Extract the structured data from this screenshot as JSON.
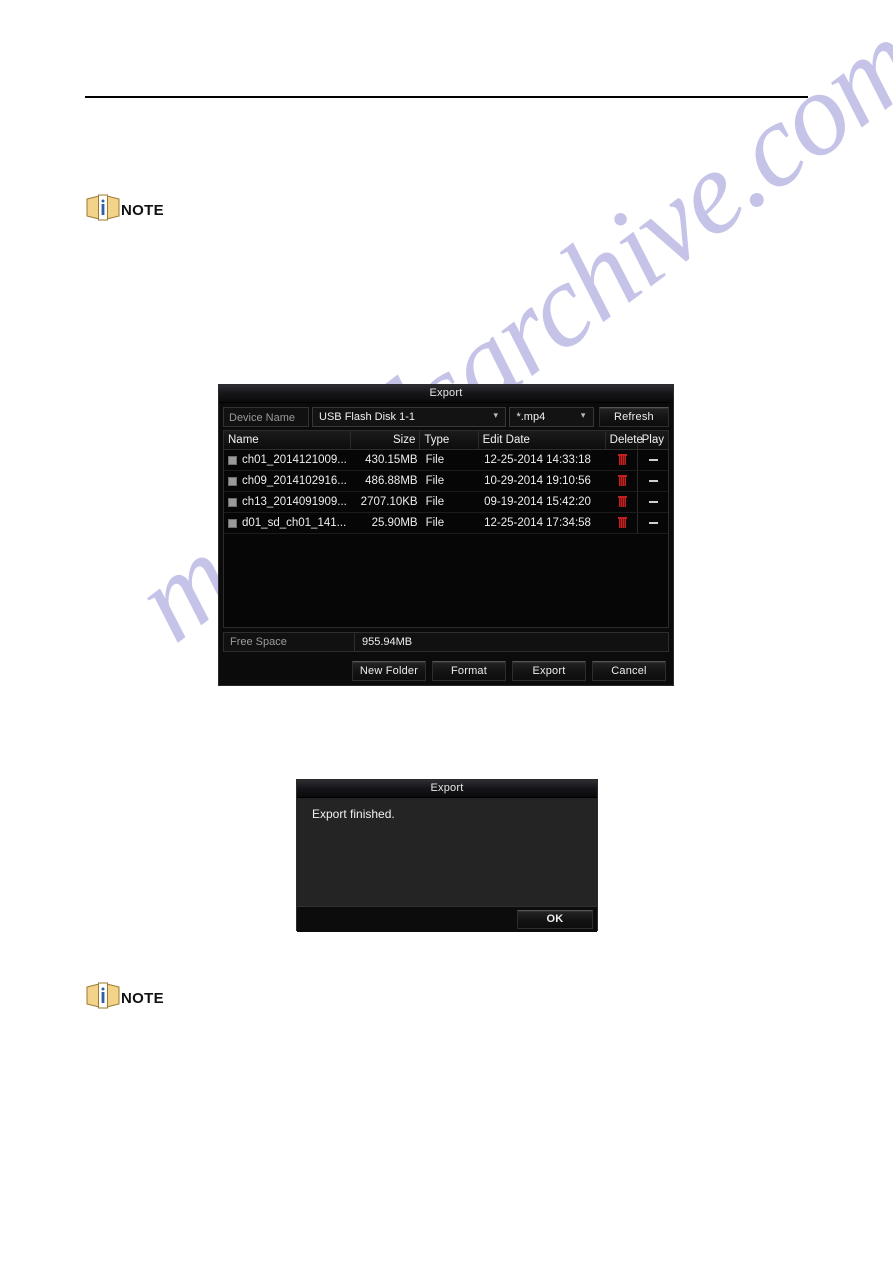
{
  "page": {
    "header_rule": true,
    "watermark_text": "manualsarchive.com"
  },
  "notes": [
    {
      "label": "NOTE",
      "icon": "note-book-icon"
    },
    {
      "label": "NOTE",
      "icon": "note-book-icon"
    }
  ],
  "export_dialog": {
    "title": "Export",
    "device_label": "Device Name",
    "device_value": "USB Flash Disk 1-1",
    "format_value": "*.mp4",
    "refresh_label": "Refresh",
    "columns": {
      "name": "Name",
      "size": "Size",
      "type": "Type",
      "date": "Edit Date",
      "delete": "Delete",
      "play": "Play"
    },
    "rows": [
      {
        "name": "ch01_2014121009...",
        "size": "430.15MB",
        "type": "File",
        "date": "12-25-2014 14:33:18",
        "delete_icon": "trash-icon",
        "play_icon": "dash-icon"
      },
      {
        "name": "ch09_2014102916...",
        "size": "486.88MB",
        "type": "File",
        "date": "10-29-2014 19:10:56",
        "delete_icon": "trash-icon",
        "play_icon": "dash-icon"
      },
      {
        "name": "ch13_2014091909...",
        "size": "2707.10KB",
        "type": "File",
        "date": "09-19-2014 15:42:20",
        "delete_icon": "trash-icon",
        "play_icon": "dash-icon"
      },
      {
        "name": "d01_sd_ch01_141...",
        "size": "25.90MB",
        "type": "File",
        "date": "12-25-2014 17:34:58",
        "delete_icon": "trash-icon",
        "play_icon": "dash-icon"
      }
    ],
    "free_space_label": "Free Space",
    "free_space_value": "955.94MB",
    "buttons": {
      "new_folder": "New Folder",
      "format": "Format",
      "export": "Export",
      "cancel": "Cancel"
    }
  },
  "finished_dialog": {
    "title": "Export",
    "message": "Export finished.",
    "ok_label": "OK"
  },
  "colors": {
    "dialog_bg": "#0b0b0b",
    "title_bar": "#1b1b20",
    "text": "#eeeeee",
    "trash_red": "#c02020",
    "watermark": "#b9b8e4",
    "note_gold": "#f5d58a",
    "note_blue": "#2f5fa8"
  }
}
